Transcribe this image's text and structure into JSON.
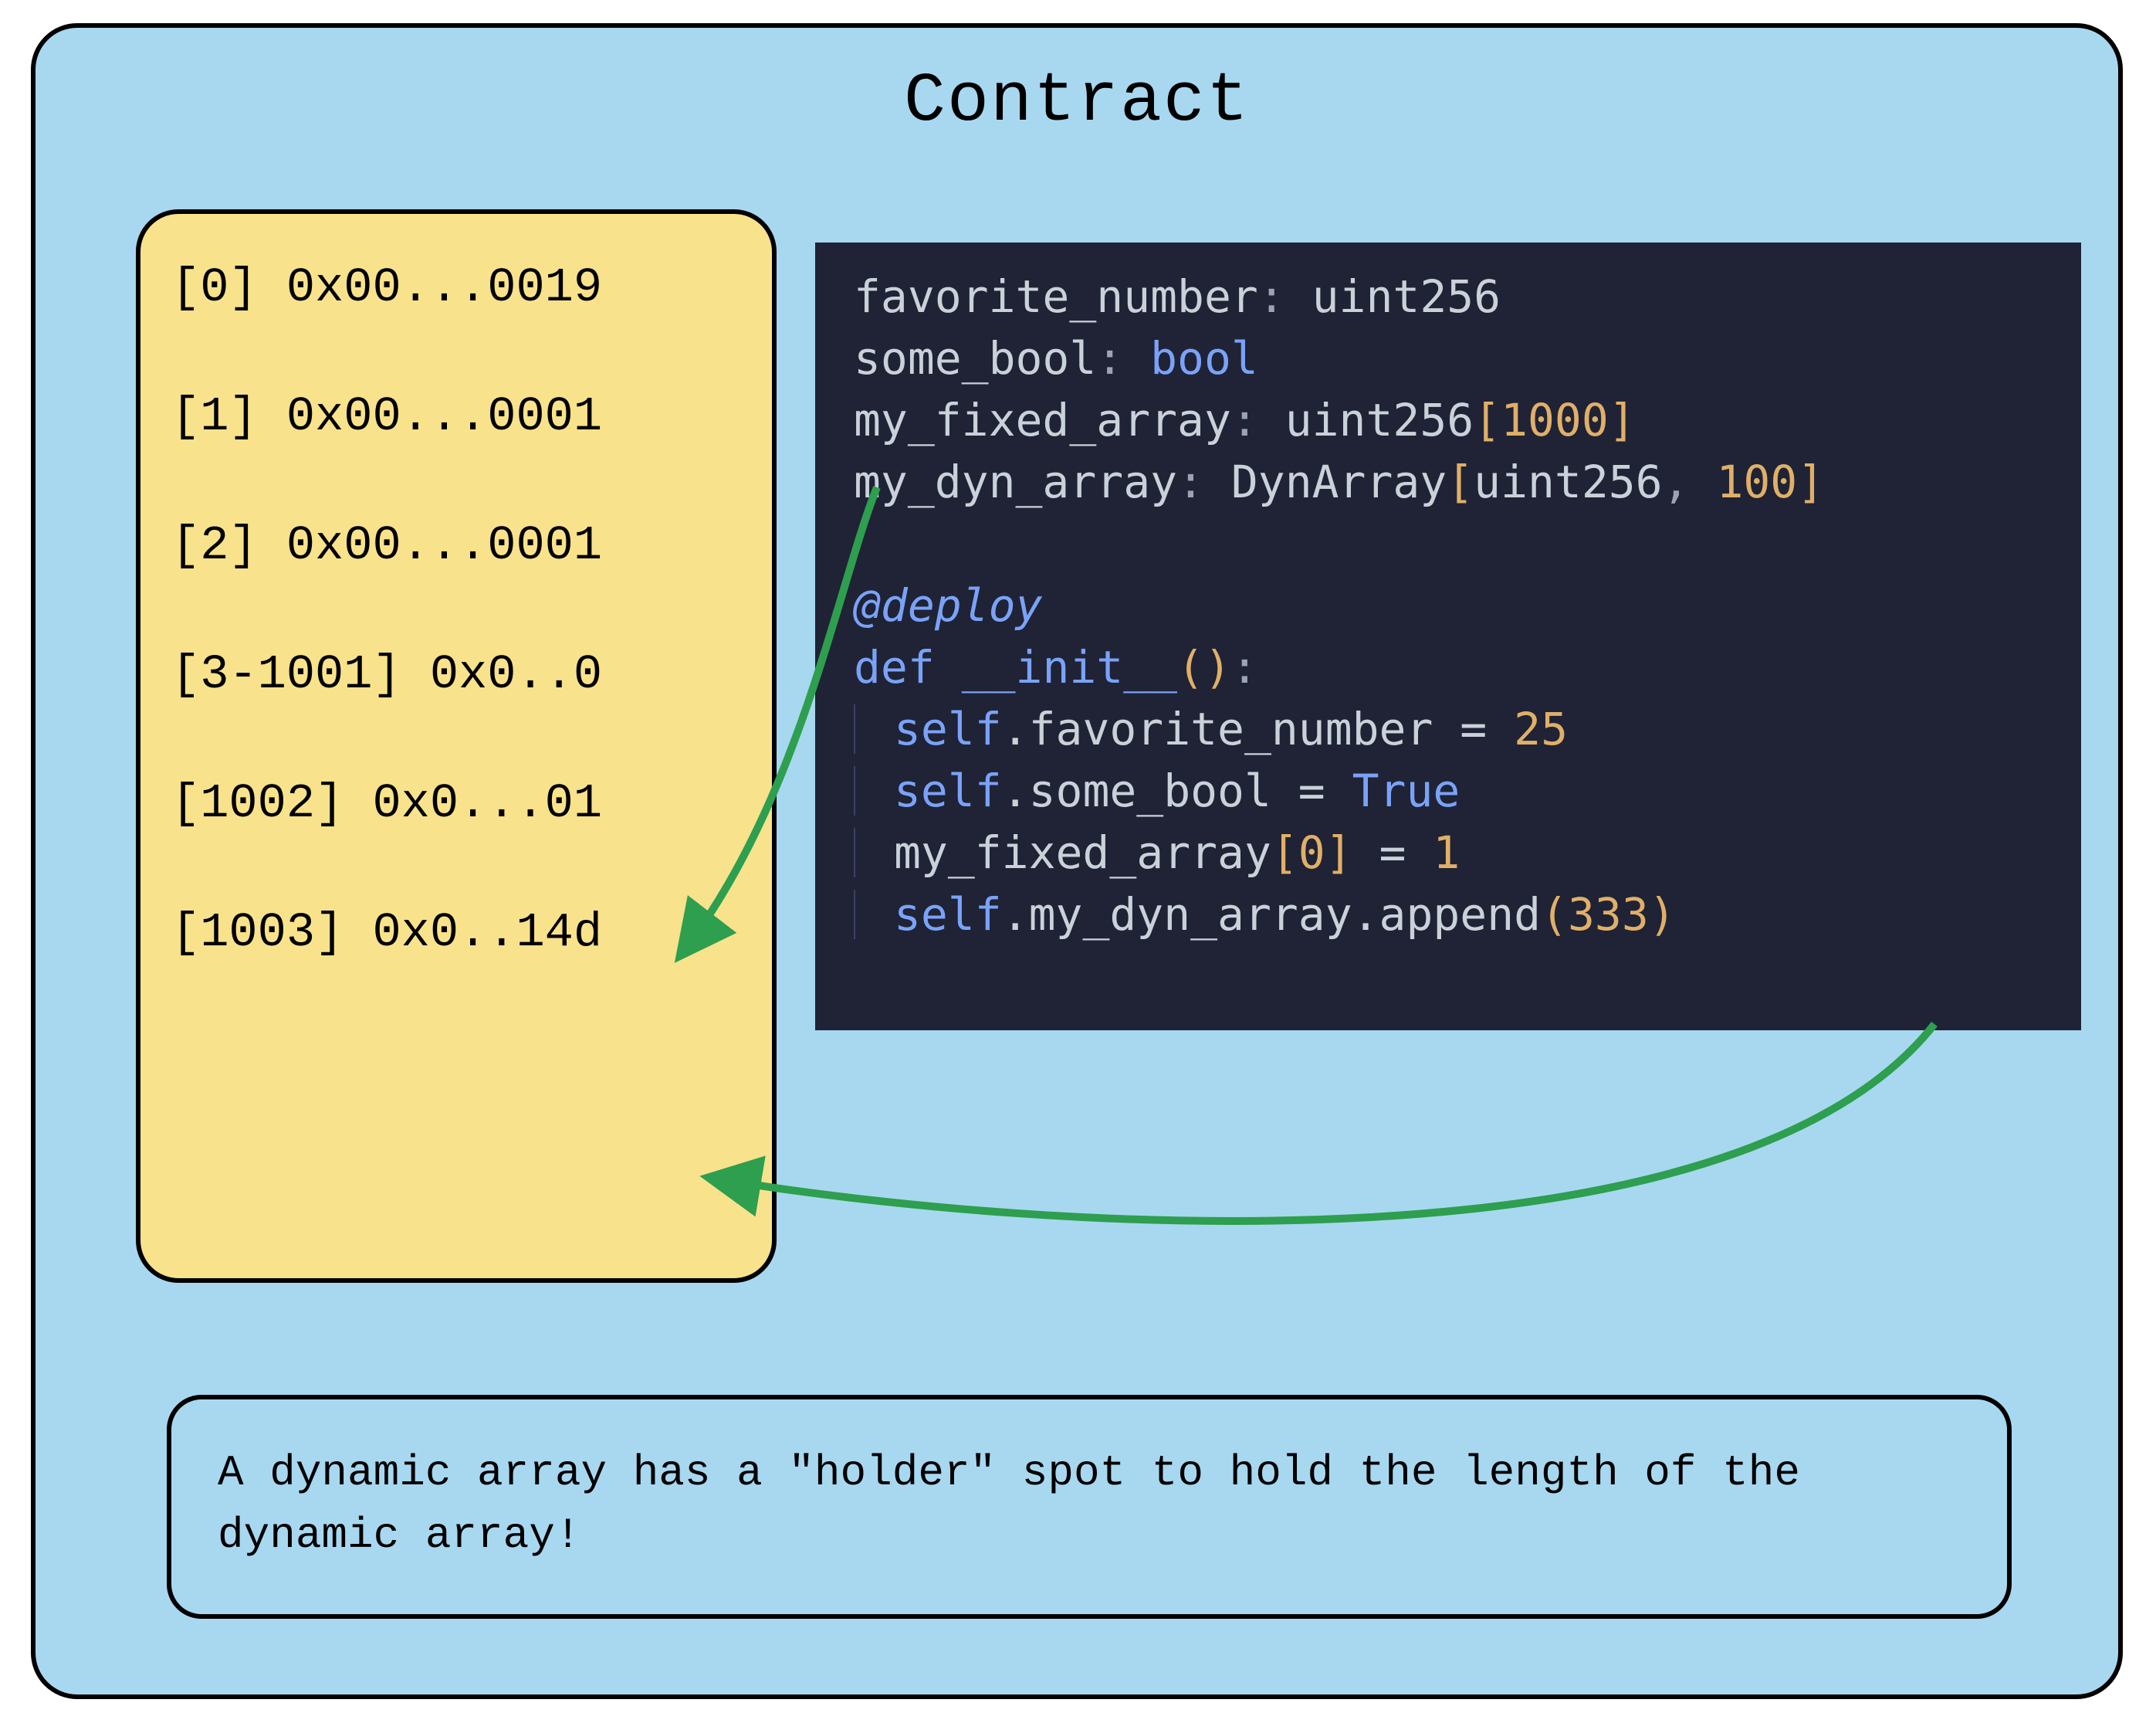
{
  "title": "Contract",
  "storage": {
    "slots": [
      {
        "label": "[0] 0x00...0019"
      },
      {
        "label": "[1] 0x00...0001"
      },
      {
        "label": "[2] 0x00...0001"
      },
      {
        "label": "[3-1001] 0x0..0"
      },
      {
        "label": "[1002] 0x0...01"
      },
      {
        "label": "[1003] 0x0..14d"
      }
    ]
  },
  "code": {
    "decl": {
      "favnum_name": "favorite_number",
      "favnum_type": "uint256",
      "bool_name": "some_bool",
      "bool_type": "bool",
      "fixed_name": "my_fixed_array",
      "fixed_type": "uint256",
      "fixed_size": "1000",
      "dyn_name": "my_dyn_array",
      "dyn_kw": "DynArray",
      "dyn_inner": "uint256",
      "dyn_size": "100"
    },
    "deco": "@deploy",
    "def_kw": "def",
    "init_name": "__init__",
    "body": {
      "l1_self": "self",
      "l1_attr": ".favorite_number = ",
      "l1_val": "25",
      "l2_self": "self",
      "l2_attr": ".some_bool = ",
      "l2_val": "True",
      "l3_name": "my_fixed_array",
      "l3_idx": "0",
      "l3_rhs": " = ",
      "l3_val": "1",
      "l4_self": "self",
      "l4_attr": ".my_dyn_array.append",
      "l4_arg": "333"
    }
  },
  "caption": "A dynamic array has a \"holder\" spot to hold the length of the dynamic array!",
  "arrows": {
    "color": "#2e9e4f"
  }
}
